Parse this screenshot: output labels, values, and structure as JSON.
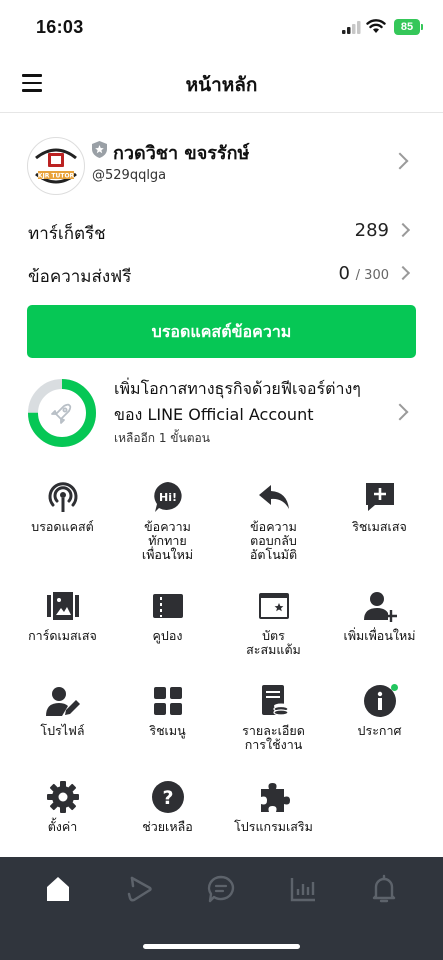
{
  "status_bar": {
    "time": "16:03",
    "battery": "85"
  },
  "header": {
    "title": "หน้าหลัก"
  },
  "account": {
    "name": "กวดวิชา ขจรรักษ์",
    "handle": "@529qqlga",
    "logo_text": "KJR TUTOR"
  },
  "stats": [
    {
      "label": "ทาร์เก็ตรีช",
      "value": "289"
    },
    {
      "label": "ข้อความส่งฟรี",
      "value": "0",
      "max": "/ 300"
    }
  ],
  "broadcast_button": "บรอดแคสต์ข้อความ",
  "promo": {
    "title": "เพิ่มโอกาสทางธุรกิจด้วยฟีเจอร์ต่างๆ ของ LINE Official Account",
    "subtitle": "เหลืออีก 1 ขั้นตอน",
    "progress": 0.75
  },
  "menu": [
    {
      "label": "บรอดแคสต์",
      "icon": "broadcast-icon"
    },
    {
      "label": "ข้อความ\nทักทาย\nเพื่อนใหม่",
      "icon": "greeting-hi-icon"
    },
    {
      "label": "ข้อความ\nตอบกลับ\nอัตโนมัติ",
      "icon": "reply-arrow-icon"
    },
    {
      "label": "ริชเมสเสจ",
      "icon": "rich-message-icon"
    },
    {
      "label": "การ์ดเมสเสจ",
      "icon": "card-message-icon"
    },
    {
      "label": "คูปอง",
      "icon": "coupon-icon"
    },
    {
      "label": "บัตร\nสะสมแต้ม",
      "icon": "reward-card-icon"
    },
    {
      "label": "เพิ่มเพื่อนใหม่",
      "icon": "add-friend-icon"
    },
    {
      "label": "โปรไฟล์",
      "icon": "profile-edit-icon"
    },
    {
      "label": "ริชเมนู",
      "icon": "rich-menu-icon"
    },
    {
      "label": "รายละเอียด\nการใช้งาน",
      "icon": "usage-details-icon"
    },
    {
      "label": "ประกาศ",
      "icon": "info-icon"
    },
    {
      "label": "ตั้งค่า",
      "icon": "gear-icon"
    },
    {
      "label": "ช่วยเหลือ",
      "icon": "help-icon"
    },
    {
      "label": "โปรแกรมเสริม",
      "icon": "puzzle-icon"
    }
  ],
  "tabbar": [
    "home-icon",
    "timeline-play-icon",
    "chat-icon",
    "analytics-icon",
    "bell-icon"
  ],
  "colors": {
    "accent": "#06c755",
    "tabbar": "#30353d",
    "icon": "#2e2f33"
  }
}
